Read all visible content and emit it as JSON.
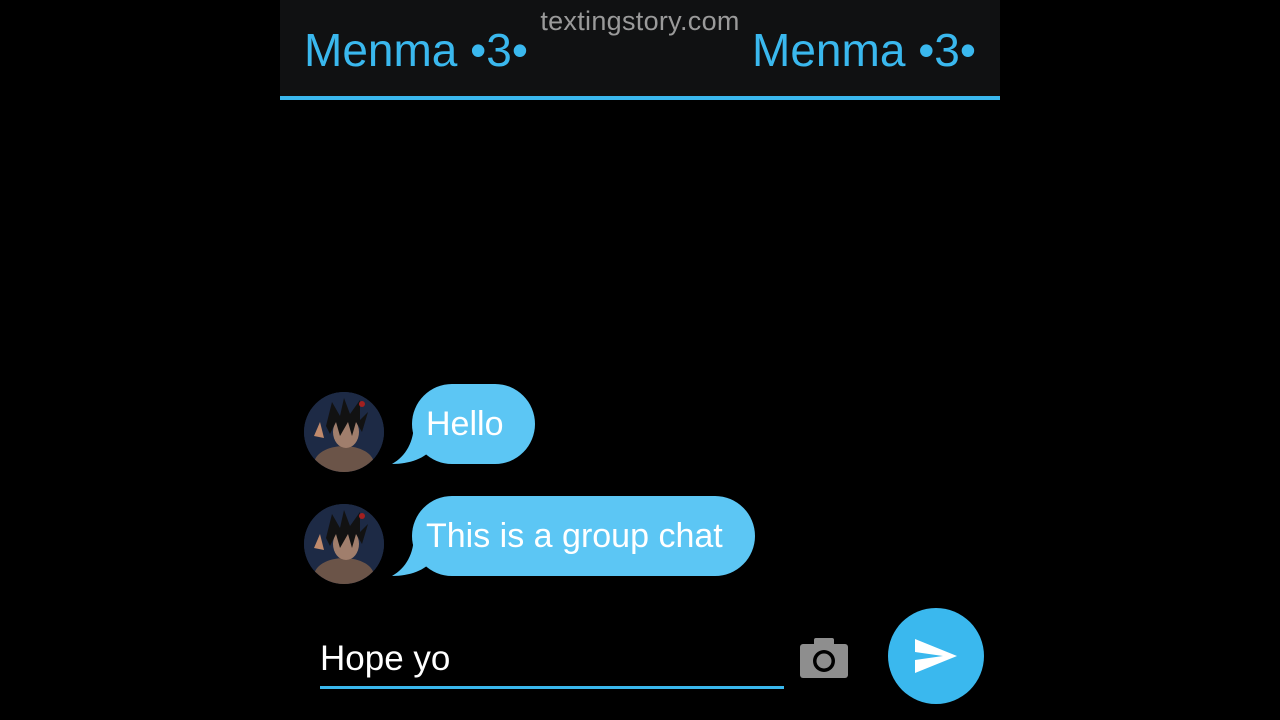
{
  "header": {
    "watermark": "textingstory.com",
    "title_left": "Menma •3•",
    "title_right": "Menma •3•"
  },
  "messages": [
    {
      "text": "Hello"
    },
    {
      "text": "This is a group chat"
    }
  ],
  "composer": {
    "value": "Hope yo"
  },
  "icons": {
    "camera": "camera-icon",
    "send": "send-icon"
  },
  "colors": {
    "accent": "#3ab8ee",
    "bubble": "#5cc6f4",
    "header_bg": "#101112",
    "background": "#000000"
  }
}
